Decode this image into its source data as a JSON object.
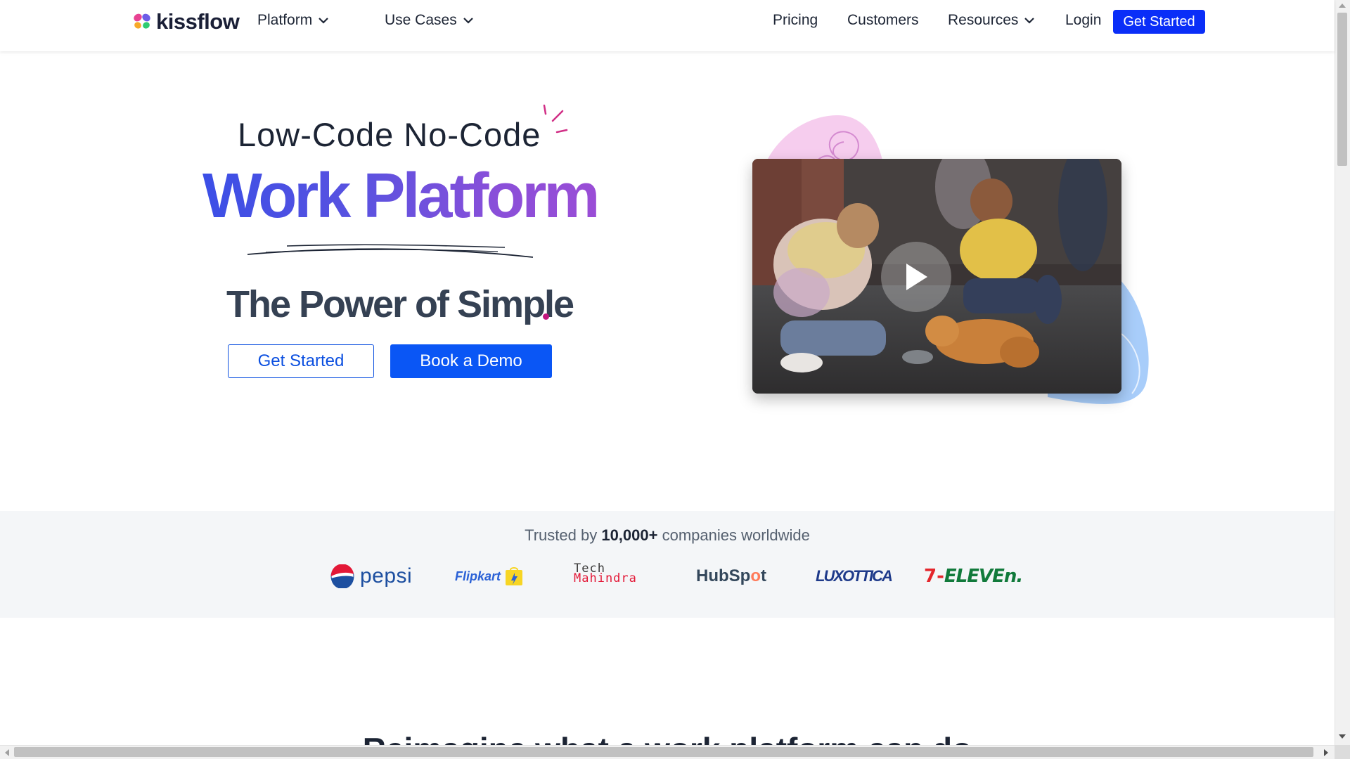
{
  "nav": {
    "logo_text": "kissflow",
    "platform": "Platform",
    "use_cases": "Use Cases",
    "pricing": "Pricing",
    "customers": "Customers",
    "resources": "Resources",
    "login": "Login",
    "get_started": "Get Started"
  },
  "hero": {
    "kicker": "Low-Code No-Code",
    "title": "Work Platform",
    "subtitle": "The Power of Simple",
    "primary_cta": "Get Started",
    "secondary_cta": "Book a Demo",
    "video_icon": "play-icon"
  },
  "trust": {
    "prefix": "Trusted by ",
    "count": "10,000+",
    "suffix": " companies worldwide",
    "logos": {
      "pepsi": "pepsi",
      "flipkart": "Flipkart",
      "techm_line1": "Tech",
      "techm_line2": "Mahindra",
      "hubspot_a": "HubSp",
      "hubspot_b": "o",
      "hubspot_c": "t",
      "luxottica": "LUXOTTICA",
      "eleven_a": "7-",
      "eleven_b": "ELEVEn."
    }
  },
  "next_section": {
    "heading": "Reimagine what a work platform can do"
  },
  "colors": {
    "brand_blue": "#0a2ef8",
    "cta_blue": "#0a56f5",
    "accent_magenta": "#c2177e",
    "title_gradient_start": "#3b4fe6",
    "title_gradient_end": "#9a4dd6"
  }
}
